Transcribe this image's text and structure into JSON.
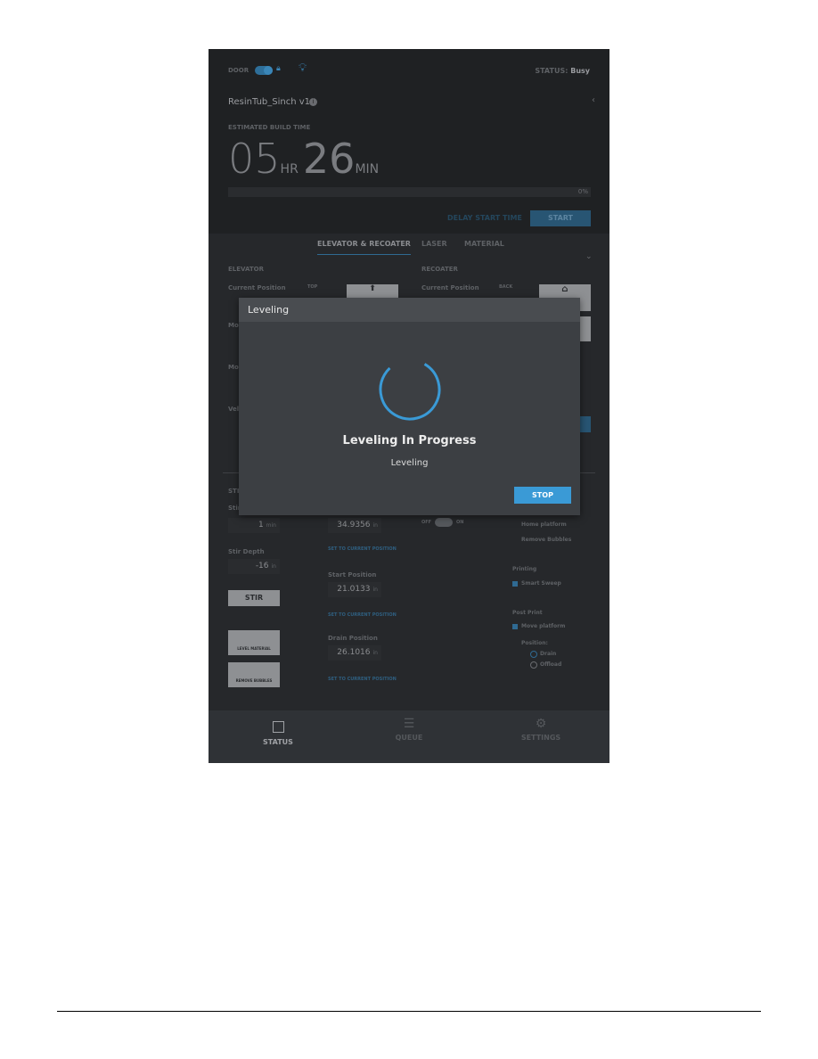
{
  "header": {
    "door_label": "DOOR",
    "status_label": "STATUS:",
    "status_value": "Busy",
    "job_name": "ResinTub_Sinch v1",
    "est_label": "ESTIMATED BUILD TIME",
    "hours": "05",
    "hr_unit": "HR",
    "minutes": "26",
    "min_unit": "MIN",
    "progress_percent": 0,
    "progress_text": "0%",
    "delay_label": "DELAY START TIME",
    "start_label": "START"
  },
  "tabs": [
    {
      "label": "ELEVATOR & RECOATER",
      "active": true
    },
    {
      "label": "LASER"
    },
    {
      "label": "MATERIAL"
    }
  ],
  "elevator": {
    "title": "ELEVATOR",
    "current_position": "Current Position",
    "top": "TOP",
    "partial": [
      "Mo",
      "Mo",
      "Vel"
    ]
  },
  "recoater": {
    "title": "RECOATER",
    "current_position": "Current Position",
    "back": "BACK"
  },
  "stir": {
    "section": "STI",
    "stir_label": "Stir",
    "stir_time": "1",
    "time_unit": "min",
    "depth_label": "Stir Depth",
    "depth": "-16",
    "unit": "in",
    "stir_button": "STIR",
    "level_material": "LEVEL MATERIAL",
    "remove_bubbles": "REMOVE BUBBLES"
  },
  "positions": {
    "value1": "34.9356",
    "set_current": "SET TO CURRENT POSITION",
    "start_label": "Start Position",
    "start_value": "21.0133",
    "drain_label": "Drain Position",
    "drain_value": "26.1016",
    "unit": "in"
  },
  "toggle": {
    "off": "OFF",
    "on": "ON"
  },
  "options": {
    "home_platform": "Home platform",
    "remove_bubbles": "Remove Bubbles",
    "printing": "Printing",
    "smart_sweep": "Smart Sweep",
    "smart_sweep_checked": true,
    "post_print": "Post Print",
    "move_platform": "Move platform",
    "move_platform_checked": true,
    "position_label": "Position:",
    "drain": "Drain",
    "offload": "Offload",
    "selected": "Drain"
  },
  "modal": {
    "title": "Leveling",
    "heading": "Leveling In Progress",
    "subtext": "Leveling",
    "stop_label": "STOP"
  },
  "bottom_nav": [
    {
      "label": "STATUS",
      "icon": "square-icon",
      "active": true
    },
    {
      "label": "QUEUE",
      "icon": "list-icon"
    },
    {
      "label": "SETTINGS",
      "icon": "gear-icon"
    }
  ],
  "colors": {
    "accent": "#3a9ad6",
    "background": "#26282b"
  }
}
